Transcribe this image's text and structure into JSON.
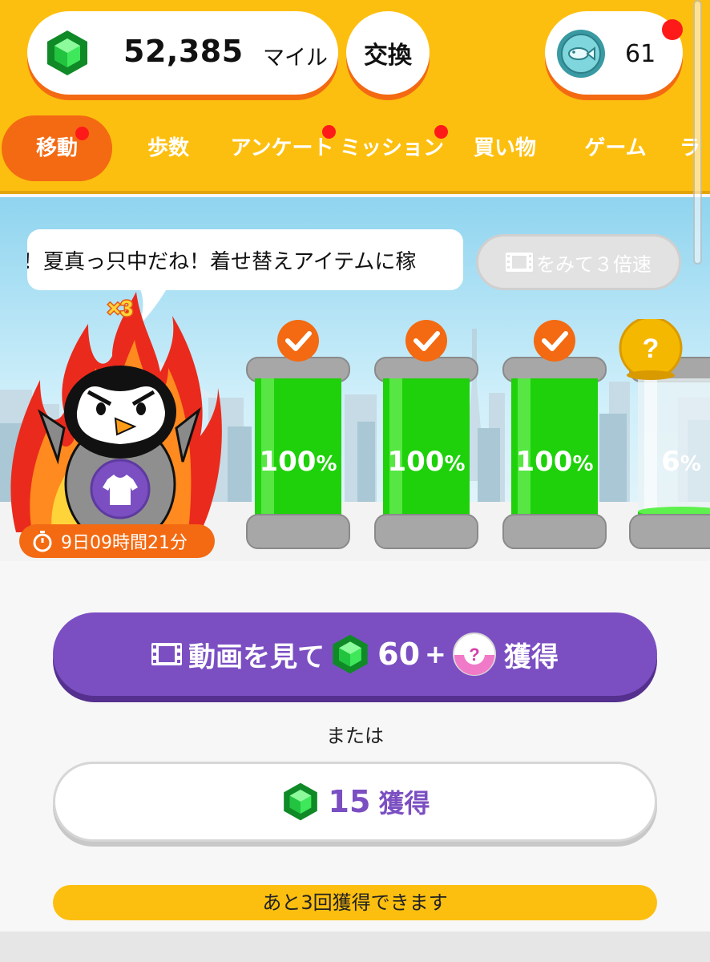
{
  "header": {
    "miles_value": "52,385",
    "miles_unit": "マイル",
    "exchange_label": "交換",
    "coin_count": "61"
  },
  "tabs": [
    {
      "label": "移動",
      "active": true,
      "badge": true
    },
    {
      "label": "歩数",
      "active": false,
      "badge": false
    },
    {
      "label": "アンケート",
      "active": false,
      "badge": true
    },
    {
      "label": "ミッション",
      "active": false,
      "badge": true
    },
    {
      "label": "買い物",
      "active": false,
      "badge": false
    },
    {
      "label": "ゲーム",
      "active": false,
      "badge": false
    },
    {
      "label": "ラ",
      "active": false,
      "badge": false
    }
  ],
  "scene": {
    "bubble_text": "！夏真っ只中だね！着せ替えアイテムに稼",
    "speed_button_label": "をみて３倍速",
    "multiplier": "×3",
    "timer": "9日09時間21分",
    "capsules": [
      {
        "percent": "100",
        "fill": 1.0,
        "status": "done"
      },
      {
        "percent": "100",
        "fill": 1.0,
        "status": "done"
      },
      {
        "percent": "100",
        "fill": 1.0,
        "status": "done"
      },
      {
        "percent": "6",
        "fill": 0.06,
        "status": "unknown"
      }
    ],
    "percent_sign": "%",
    "unknown_badge": "?"
  },
  "actions": {
    "video_button": {
      "prefix": "動画を見て",
      "amount": "60",
      "plus": "+",
      "suffix": "獲得"
    },
    "or_text": "または",
    "earn_button": {
      "amount": "15",
      "suffix": "獲得"
    },
    "remaining_text": "あと3回獲得できます"
  },
  "colors": {
    "header": "#fdbf0f",
    "accent_orange": "#f36a12",
    "purple": "#7b4fc2",
    "capsule_green": "#1ed10a",
    "notification_red": "#ff1a1a"
  },
  "icons": {
    "gem": "green-gem-icon",
    "coin": "fish-coin-icon",
    "film": "film-icon",
    "check": "check-icon",
    "timer": "stopwatch-icon",
    "mystery": "question-capsule-icon",
    "shirt": "shirt-icon"
  }
}
